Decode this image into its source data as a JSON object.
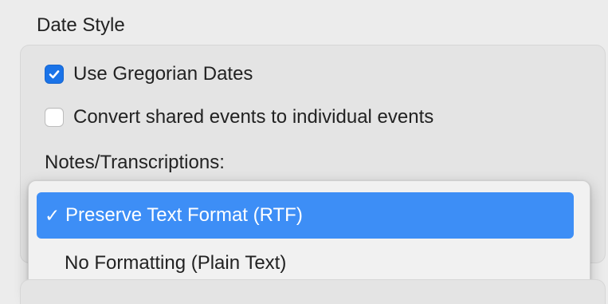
{
  "section": {
    "title": "Date Style"
  },
  "options": {
    "gregorian": {
      "label": "Use Gregorian Dates",
      "checked": true
    },
    "convert_shared": {
      "label": "Convert shared events to individual events",
      "checked": false
    }
  },
  "notes": {
    "label": "Notes/Transcriptions:"
  },
  "dropdown": {
    "selected_label": "Preserve Text Format (RTF)",
    "other_label": "No Formatting (Plain Text)",
    "selected_mark": "✓"
  },
  "colors": {
    "accent": "#3d8ef6",
    "checkbox_checked": "#1a73e8"
  }
}
